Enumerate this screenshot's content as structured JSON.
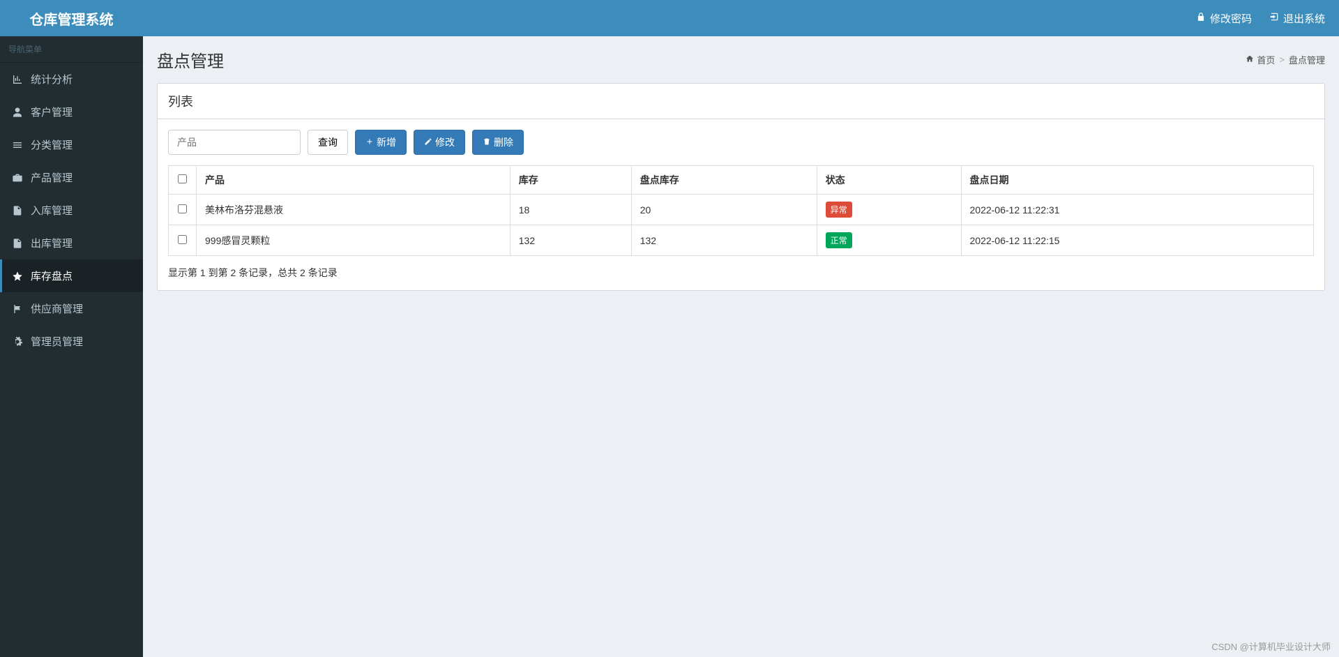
{
  "header": {
    "app_title": "仓库管理系统",
    "change_password": "修改密码",
    "logout": "退出系统"
  },
  "sidebar": {
    "menu_label": "导航菜单",
    "items": [
      {
        "label": "统计分析",
        "icon": "bar-chart-icon",
        "active": false
      },
      {
        "label": "客户管理",
        "icon": "user-icon",
        "active": false
      },
      {
        "label": "分类管理",
        "icon": "list-icon",
        "active": false
      },
      {
        "label": "产品管理",
        "icon": "briefcase-icon",
        "active": false
      },
      {
        "label": "入库管理",
        "icon": "file-icon",
        "active": false
      },
      {
        "label": "出库管理",
        "icon": "file-out-icon",
        "active": false
      },
      {
        "label": "库存盘点",
        "icon": "star-icon",
        "active": true
      },
      {
        "label": "供应商管理",
        "icon": "flag-icon",
        "active": false
      },
      {
        "label": "管理员管理",
        "icon": "gear-icon",
        "active": false
      }
    ]
  },
  "page": {
    "title": "盘点管理",
    "breadcrumb": {
      "home": "首页",
      "current": "盘点管理"
    }
  },
  "panel": {
    "header": "列表"
  },
  "toolbar": {
    "search_placeholder": "产品",
    "query_label": "查询",
    "add_label": "新增",
    "edit_label": "修改",
    "delete_label": "删除"
  },
  "table": {
    "columns": {
      "product": "产品",
      "stock": "库存",
      "count_stock": "盘点库存",
      "status": "状态",
      "count_date": "盘点日期"
    },
    "rows": [
      {
        "product": "美林布洛芬混悬液",
        "stock": "18",
        "count_stock": "20",
        "status": "异常",
        "status_type": "danger",
        "date": "2022-06-12 11:22:31"
      },
      {
        "product": "999感冒灵颗粒",
        "stock": "132",
        "count_stock": "132",
        "status": "正常",
        "status_type": "success",
        "date": "2022-06-12 11:22:15"
      }
    ]
  },
  "pagination": {
    "info": "显示第 1 到第 2 条记录，总共 2 条记录"
  },
  "watermark": "CSDN @计算机毕业设计大师"
}
